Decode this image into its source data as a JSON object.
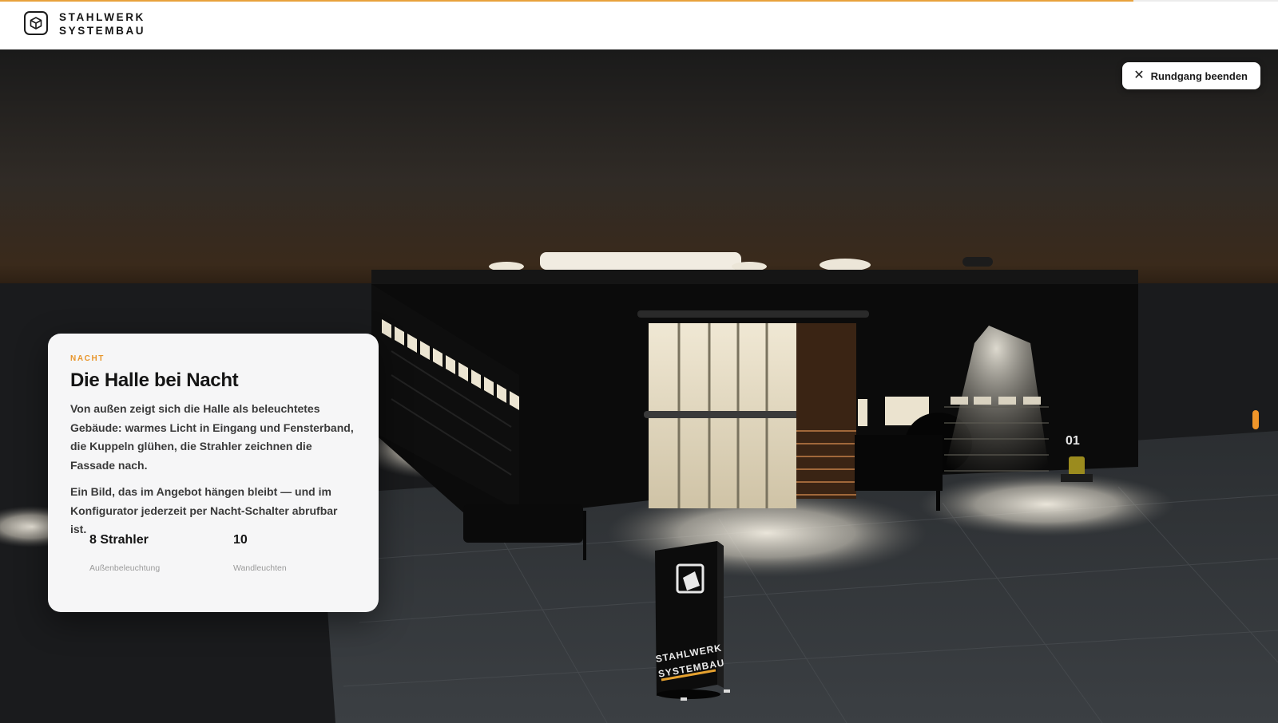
{
  "brand": {
    "line1": "STAHLWERK",
    "line2": "SYSTEMBAU",
    "accent": "#e8a23c"
  },
  "tour": {
    "progress_fraction": 0.887
  },
  "exit_button": {
    "label": "Rundgang beenden",
    "icon": "close-icon"
  },
  "card": {
    "eyebrow": "NACHT",
    "title": "Die Halle bei Nacht",
    "paragraphs": [
      "Von außen zeigt sich die Halle als beleuchtetes Gebäude: warmes Licht in Eingang und Fensterband, die Kuppeln glühen, die Strahler zeichnen die Fassade nach.",
      "Ein Bild, das im Angebot hängen bleibt — und im Konfigurator jederzeit per Nacht-Schalter abrufbar ist."
    ],
    "stats": [
      {
        "value": "8 Strahler",
        "label": "Außenbeleuchtung"
      },
      {
        "value": "10",
        "label": "Wandleuchten"
      }
    ]
  },
  "scene": {
    "door_number": "01",
    "sign": {
      "line1": "STAHLWERK",
      "line2": "SYSTEMBAU"
    }
  }
}
